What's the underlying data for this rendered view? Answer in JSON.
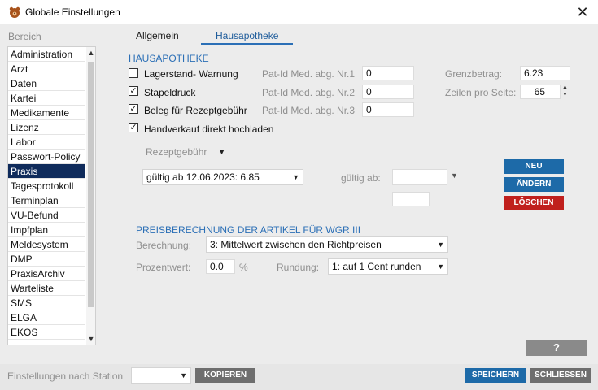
{
  "window": {
    "title": "Globale Einstellungen",
    "close": "✕"
  },
  "sidebar": {
    "label": "Bereich",
    "items": [
      "Administration",
      "Arzt",
      "Daten",
      "Kartei",
      "Medikamente",
      "Lizenz",
      "Labor",
      "Passwort-Policy",
      "Praxis",
      "Tagesprotokoll",
      "Terminplan",
      "VU-Befund",
      "Impfplan",
      "Meldesystem",
      "DMP",
      "PraxisArchiv",
      "Warteliste",
      "SMS",
      "ELGA",
      "EKOS"
    ],
    "selected": "Praxis",
    "scroll_up": "▲",
    "scroll_down": "▼"
  },
  "tabs": [
    "Allgemein",
    "Hausapotheke"
  ],
  "active_tab": "Hausapotheke",
  "hausapotheke": {
    "header": "HAUSAPOTHEKE",
    "checks": [
      {
        "label": "Lagerstand- Warnung",
        "checked": false
      },
      {
        "label": "Stapeldruck",
        "checked": true
      },
      {
        "label": "Beleg für Rezeptgebühr",
        "checked": true
      },
      {
        "label": "Handverkauf direkt hochladen",
        "checked": true
      }
    ],
    "patid": [
      {
        "label": "Pat-Id Med. abg. Nr.1",
        "value": "0"
      },
      {
        "label": "Pat-Id Med. abg. Nr.2",
        "value": "0"
      },
      {
        "label": "Pat-Id Med. abg. Nr.3",
        "value": "0"
      }
    ],
    "grenzbetrag": {
      "label": "Grenzbetrag:",
      "value": "6.23"
    },
    "zeilen": {
      "label": "Zeilen pro Seite:",
      "value": "65"
    },
    "rezeptgebuehr": {
      "value": "Rezeptgebühr"
    },
    "gueltig_combo": {
      "value": "gültig ab 12.06.2023:   6.85"
    },
    "gueltig_ab": {
      "label": "gültig ab:",
      "value": ""
    },
    "extra_value": "",
    "buttons": {
      "neu": "NEU",
      "aendern": "ÄNDERN",
      "loeschen": "LÖSCHEN"
    }
  },
  "preis": {
    "header": "PREISBERECHNUNG DER ARTIKEL FÜR WGR III",
    "berechnung": {
      "label": "Berechnung:",
      "value": "3: Mittelwert zwischen den Richtpreisen"
    },
    "prozentwert": {
      "label": "Prozentwert:",
      "value": "0.0",
      "unit": "%"
    },
    "rundung": {
      "label": "Rundung:",
      "value": "1: auf  1 Cent runden"
    }
  },
  "help": "?",
  "footer": {
    "station_label": "Einstellungen nach Station",
    "station_value": "",
    "kopieren": "KOPIEREN",
    "speichern": "SPEICHERN",
    "schliessen": "SCHLIESSEN"
  },
  "colors": {
    "accent": "#2b6fb6",
    "selected_nav": "#0f2b5b",
    "button_blue": "#1d6aa8",
    "button_red": "#c0201d"
  },
  "icons": {
    "app": "pharmacy-bear-icon",
    "arrow": "▼"
  }
}
